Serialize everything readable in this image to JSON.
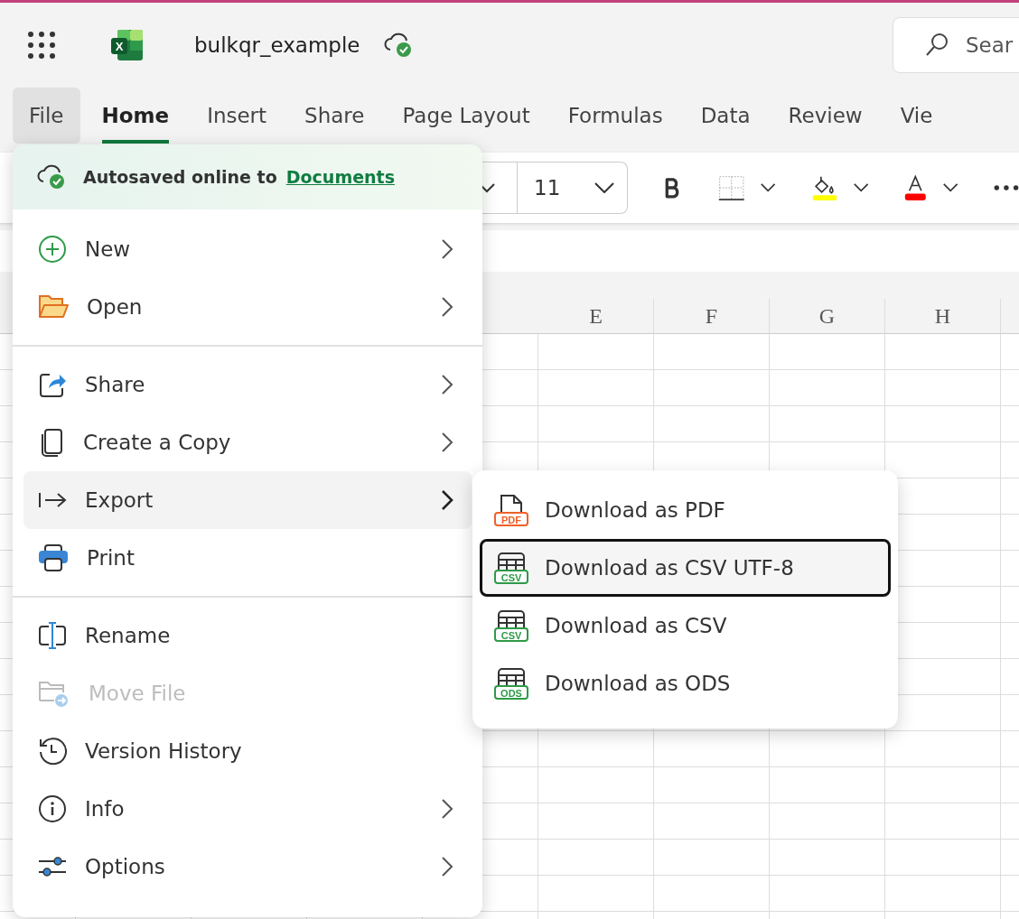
{
  "app": {
    "logo_letter": "X",
    "title": "bulkqr_example",
    "search": {
      "placeholder": "Sear"
    }
  },
  "tabs": [
    {
      "label": "File",
      "selected": false,
      "pressed": true
    },
    {
      "label": "Home",
      "selected": true,
      "pressed": false
    },
    {
      "label": "Insert",
      "selected": false,
      "pressed": false
    },
    {
      "label": "Share",
      "selected": false,
      "pressed": false
    },
    {
      "label": "Page Layout",
      "selected": false,
      "pressed": false
    },
    {
      "label": "Formulas",
      "selected": false,
      "pressed": false
    },
    {
      "label": "Data",
      "selected": false,
      "pressed": false
    },
    {
      "label": "Review",
      "selected": false,
      "pressed": false
    },
    {
      "label": "Vie",
      "selected": false,
      "pressed": false
    }
  ],
  "toolbar": {
    "font_size": "11"
  },
  "columns": [
    "E",
    "F",
    "G",
    "H"
  ],
  "file_menu": {
    "status": {
      "text": "Autosaved online to",
      "link": "Documents"
    },
    "groups": [
      [
        {
          "label": "New",
          "kind": "new",
          "has_submenu": true,
          "highlighted": false,
          "disabled": false
        },
        {
          "label": "Open",
          "kind": "open",
          "has_submenu": true,
          "highlighted": false,
          "disabled": false
        }
      ],
      [
        {
          "label": "Share",
          "kind": "share",
          "has_submenu": true,
          "highlighted": false,
          "disabled": false
        },
        {
          "label": "Create a Copy",
          "kind": "copy",
          "has_submenu": true,
          "highlighted": false,
          "disabled": false
        },
        {
          "label": "Export",
          "kind": "export",
          "has_submenu": true,
          "highlighted": true,
          "disabled": false
        },
        {
          "label": "Print",
          "kind": "print",
          "has_submenu": false,
          "highlighted": false,
          "disabled": false
        }
      ],
      [
        {
          "label": "Rename",
          "kind": "rename",
          "has_submenu": false,
          "highlighted": false,
          "disabled": false
        },
        {
          "label": "Move File",
          "kind": "move",
          "has_submenu": false,
          "highlighted": false,
          "disabled": true
        },
        {
          "label": "Version History",
          "kind": "history",
          "has_submenu": false,
          "highlighted": false,
          "disabled": false
        },
        {
          "label": "Info",
          "kind": "info",
          "has_submenu": true,
          "highlighted": false,
          "disabled": false
        },
        {
          "label": "Options",
          "kind": "options",
          "has_submenu": true,
          "highlighted": false,
          "disabled": false
        }
      ]
    ]
  },
  "export_menu": [
    {
      "label": "Download as PDF",
      "kind": "pdf",
      "badge": "PDF",
      "selected": false
    },
    {
      "label": "Download as CSV UTF-8",
      "kind": "sheet",
      "badge": "CSV",
      "selected": true
    },
    {
      "label": "Download as CSV",
      "kind": "sheet",
      "badge": "CSV",
      "selected": false
    },
    {
      "label": "Download as ODS",
      "kind": "sheet",
      "badge": "ODS",
      "selected": false
    }
  ]
}
